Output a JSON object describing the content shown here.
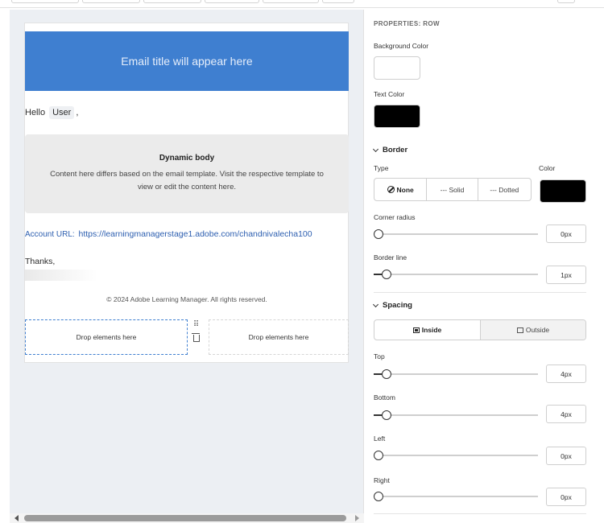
{
  "email": {
    "header_text": "Email title will appear here",
    "greeting": "Hello",
    "user_chip": "User",
    "greeting_suffix": ",",
    "dynamic_body_title": "Dynamic body",
    "dynamic_body_text": "Content here differs based on the email template. Visit the respective template to view or edit the content here.",
    "account_label": "Account URL:",
    "account_url": "https://learningmanagerstage1.adobe.com/chandnivalecha100",
    "thanks": "Thanks,",
    "copyright": "© 2024 Adobe Learning Manager. All rights reserved.",
    "drop_left": "Drop elements here",
    "drop_right": "Drop elements here",
    "header_color": "#3f7fd0",
    "drag_glyph": "⠿"
  },
  "panel": {
    "title": "PROPERTIES: ROW",
    "background_color_label": "Background Color",
    "background_color": "#ffffff",
    "text_color_label": "Text Color",
    "text_color": "#000000",
    "border_section": "Border",
    "type_label": "Type",
    "color_label": "Color",
    "border_color": "#000000",
    "border_types": [
      {
        "label": "None",
        "icon": "none-icon",
        "active": true
      },
      {
        "label": "--- Solid",
        "active": false
      },
      {
        "label": "--- Dotted",
        "active": false
      }
    ],
    "corner_radius_label": "Corner radius",
    "corner_radius_value": "0px",
    "corner_radius_level": 0,
    "border_line_label": "Border line",
    "border_line_value": "1px",
    "border_line_level": 0.05,
    "spacing_section": "Spacing",
    "spacing_modes": [
      {
        "label": "Inside",
        "icon": "inside-icon",
        "active": true
      },
      {
        "label": "Outside",
        "icon": "outside-icon",
        "active": false
      }
    ],
    "top_label": "Top",
    "top_value": "4px",
    "top_level": 0.05,
    "bottom_label": "Bottom",
    "bottom_value": "4px",
    "bottom_level": 0.05,
    "left_label": "Left",
    "left_value": "0px",
    "left_level": 0,
    "right_label": "Right",
    "right_value": "0px",
    "right_level": 0
  }
}
